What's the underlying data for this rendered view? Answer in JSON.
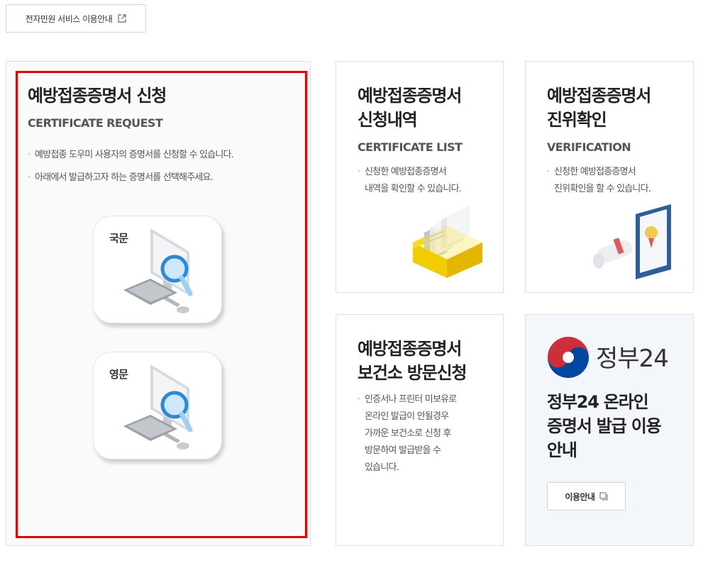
{
  "top_button": {
    "label": "전자민원 서비스 이용안내"
  },
  "request": {
    "title": "예방접종증명서 신청",
    "subtitle": "CERTIFICATE REQUEST",
    "bullets": [
      "예방접종 도우미 사용자의 증명서를 신청할 수 있습니다.",
      "아래에서 발급하고자 하는 증명서를 선택해주세요."
    ],
    "korean_label": "국문",
    "english_label": "영문"
  },
  "list": {
    "title": "예방접종증명서\n신청내역",
    "subtitle": "CERTIFICATE LIST",
    "bullet": "신청한 예방접종증명서\n내역을 확인할 수 있습니다."
  },
  "verify": {
    "title": "예방접종증명서\n진위확인",
    "subtitle": "VERIFICATION",
    "bullet": "신청한 예방접종증명서\n진위확인을 할 수 있습니다."
  },
  "visit": {
    "title": "예방접종증명서\n보건소 방문신청",
    "bullet": "인증서나 프린터 미보유로\n온라인 발급이 안될경우\n가까운 보건소로 신청 후\n방문하여 발급받을 수\n있습니다."
  },
  "gov24": {
    "brand": "정부24",
    "title": "정부24 온라인\n증명서 발급 이용\n안내",
    "button_label": "이용안내"
  },
  "colors": {
    "highlight": "#e20000",
    "gov_red": "#cd2e3a",
    "gov_blue": "#0047a0",
    "magnifier": "#2a8ad6"
  }
}
